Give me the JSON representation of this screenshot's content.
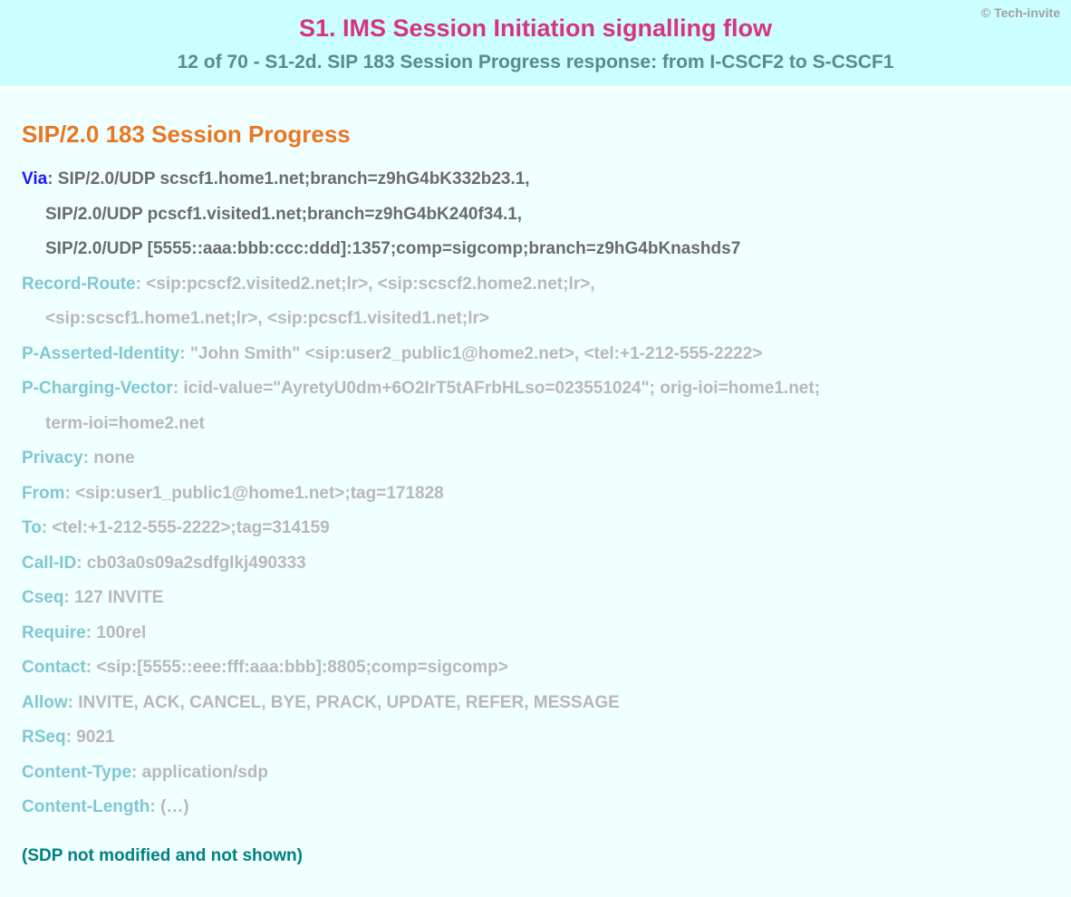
{
  "banner": {
    "copyright": "© Tech-invite",
    "title": "S1. IMS Session Initiation signalling flow",
    "subtitle": "12 of 70 - S1-2d. SIP 183 Session Progress response: from I-CSCF2 to S-CSCF1"
  },
  "sip": {
    "status_line": "SIP/2.0 183 Session Progress",
    "via": {
      "name": "Via",
      "sep": ": ",
      "line1": "SIP/2.0/UDP scscf1.home1.net;branch=z9hG4bK332b23.1,",
      "line2": "SIP/2.0/UDP pcscf1.visited1.net;branch=z9hG4bK240f34.1,",
      "line3": "SIP/2.0/UDP [5555::aaa:bbb:ccc:ddd]:1357;comp=sigcomp;branch=z9hG4bKnashds7"
    },
    "record_route": {
      "name": "Record-Route",
      "sep": ": ",
      "line1": "<sip:pcscf2.visited2.net;lr>, <sip:scscf2.home2.net;lr>,",
      "line2": "<sip:scscf1.home1.net;lr>, <sip:pcscf1.visited1.net;lr>"
    },
    "p_asserted_identity": {
      "name": "P-Asserted-Identity",
      "sep": ": ",
      "value": "\"John Smith\" <sip:user2_public1@home2.net>, <tel:+1-212-555-2222>"
    },
    "p_charging_vector": {
      "name": "P-Charging-Vector",
      "sep": ": ",
      "line1": "icid-value=\"AyretyU0dm+6O2IrT5tAFrbHLso=023551024\"; orig-ioi=home1.net;",
      "line2": "term-ioi=home2.net"
    },
    "privacy": {
      "name": "Privacy",
      "sep": ": ",
      "value": "none"
    },
    "from": {
      "name": "From",
      "sep": ": ",
      "value": "<sip:user1_public1@home1.net>;tag=171828"
    },
    "to": {
      "name": "To",
      "sep": ": ",
      "value": "<tel:+1-212-555-2222>;tag=314159"
    },
    "call_id": {
      "name": "Call-ID",
      "sep": ": ",
      "value": "cb03a0s09a2sdfglkj490333"
    },
    "cseq": {
      "name": "Cseq",
      "sep": ": ",
      "value": "127 INVITE"
    },
    "require": {
      "name": "Require",
      "sep": ": ",
      "value": "100rel"
    },
    "contact": {
      "name": "Contact",
      "sep": ": ",
      "value": "<sip:[5555::eee:fff:aaa:bbb]:8805;comp=sigcomp>"
    },
    "allow": {
      "name": "Allow",
      "sep": ": ",
      "value": "INVITE, ACK, CANCEL, BYE, PRACK, UPDATE, REFER, MESSAGE"
    },
    "rseq": {
      "name": "RSeq",
      "sep": ": ",
      "value": "9021"
    },
    "content_type": {
      "name": "Content-Type",
      "sep": ": ",
      "value": "application/sdp"
    },
    "content_length": {
      "name": "Content-Length",
      "sep": ": ",
      "value": "(…)"
    },
    "footer_note": "(SDP not modified and not shown)"
  }
}
